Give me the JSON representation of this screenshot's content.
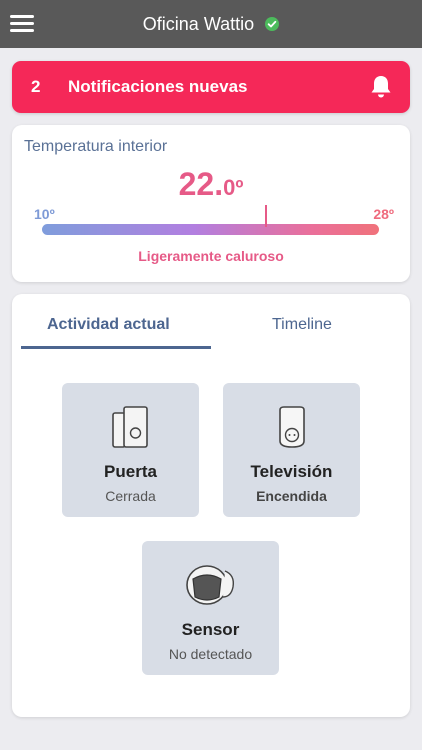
{
  "header": {
    "title": "Oficina Wattio",
    "menu_icon": "hamburger-menu-icon",
    "status_icon": "check-circle-icon",
    "status_color": "#4cbb5c"
  },
  "notifications": {
    "count": "2",
    "label": "Notificaciones nuevas",
    "icon": "bell-icon",
    "color": "#f52858"
  },
  "temperature": {
    "title": "Temperatura interior",
    "value_int": "22.",
    "value_dec": "0º",
    "value": 22.0,
    "min_label": "10º",
    "max_label": "28º",
    "min": 10,
    "max": 28,
    "status": "Ligeramente caluroso"
  },
  "activity": {
    "tabs": [
      {
        "label": "Actividad actual",
        "active": true
      },
      {
        "label": "Timeline",
        "active": false
      }
    ],
    "devices": [
      {
        "name": "Puerta",
        "state": "Cerrada",
        "icon": "door-sensor-icon"
      },
      {
        "name": "Televisión",
        "state": "Encendida",
        "icon": "smart-plug-icon"
      },
      {
        "name": "Sensor",
        "state": "No detectado",
        "icon": "motion-sensor-icon"
      }
    ]
  }
}
